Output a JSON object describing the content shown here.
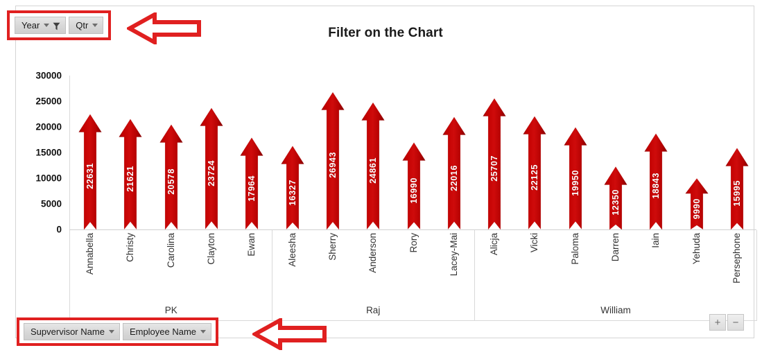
{
  "title": "Filter on the Chart",
  "top_slicers": [
    {
      "label": "Year",
      "icon": "filter-funnel-icon",
      "has_caret": true
    },
    {
      "label": "Qtr",
      "icon": "chevron-down-icon",
      "has_caret": true
    }
  ],
  "bottom_slicers": [
    {
      "label": "Supvervisor Name",
      "icon": "chevron-down-icon"
    },
    {
      "label": "Employee Name",
      "icon": "chevron-down-icon"
    }
  ],
  "expand_buttons": [
    {
      "label": "+",
      "name": "expand-field-button"
    },
    {
      "label": "−",
      "name": "collapse-field-button"
    }
  ],
  "annotations": [
    {
      "name": "pointer-arrow-top",
      "direction": "left",
      "color": "#e02020"
    },
    {
      "name": "pointer-arrow-bottom",
      "direction": "left",
      "color": "#e02020"
    }
  ],
  "colors": {
    "bar": "#c00000",
    "bar_dark": "#a40000",
    "highlight_box": "#e02020",
    "grid": "#d9d9d9",
    "text": "#333333"
  },
  "chart_data": {
    "type": "bar",
    "title": "Filter on the Chart",
    "xlabel": "",
    "ylabel": "",
    "ylim": [
      0,
      30000
    ],
    "yticks": [
      30000,
      25000,
      20000,
      15000,
      10000,
      5000,
      0
    ],
    "grid": false,
    "legend": "none",
    "marker_style": "up-arrow",
    "group_field": "Supvervisor Name",
    "category_field": "Employee Name",
    "groups": [
      {
        "name": "PK",
        "categories": [
          "Annabella",
          "Christy",
          "Carolina",
          "Clayton",
          "Ewan"
        ],
        "values": [
          22631,
          21621,
          20578,
          23724,
          17964
        ]
      },
      {
        "name": "Raj",
        "categories": [
          "Aleesha",
          "Sherry",
          "Anderson",
          "Rory",
          "Lacey-Mai"
        ],
        "values": [
          16327,
          26943,
          24861,
          16990,
          22016
        ]
      },
      {
        "name": "William",
        "categories": [
          "Alicja",
          "Vicki",
          "Paloma",
          "Darren",
          "Iain",
          "Yehuda",
          "Persephone"
        ],
        "values": [
          25707,
          22125,
          19950,
          12350,
          18843,
          9990,
          15995
        ]
      }
    ],
    "categories": [
      "Annabella",
      "Christy",
      "Carolina",
      "Clayton",
      "Ewan",
      "Aleesha",
      "Sherry",
      "Anderson",
      "Rory",
      "Lacey-Mai",
      "Alicja",
      "Vicki",
      "Paloma",
      "Darren",
      "Iain",
      "Yehuda",
      "Persephone"
    ],
    "values": [
      22631,
      21621,
      20578,
      23724,
      17964,
      16327,
      26943,
      24861,
      16990,
      22016,
      25707,
      22125,
      19950,
      12350,
      18843,
      9990,
      15995
    ]
  }
}
